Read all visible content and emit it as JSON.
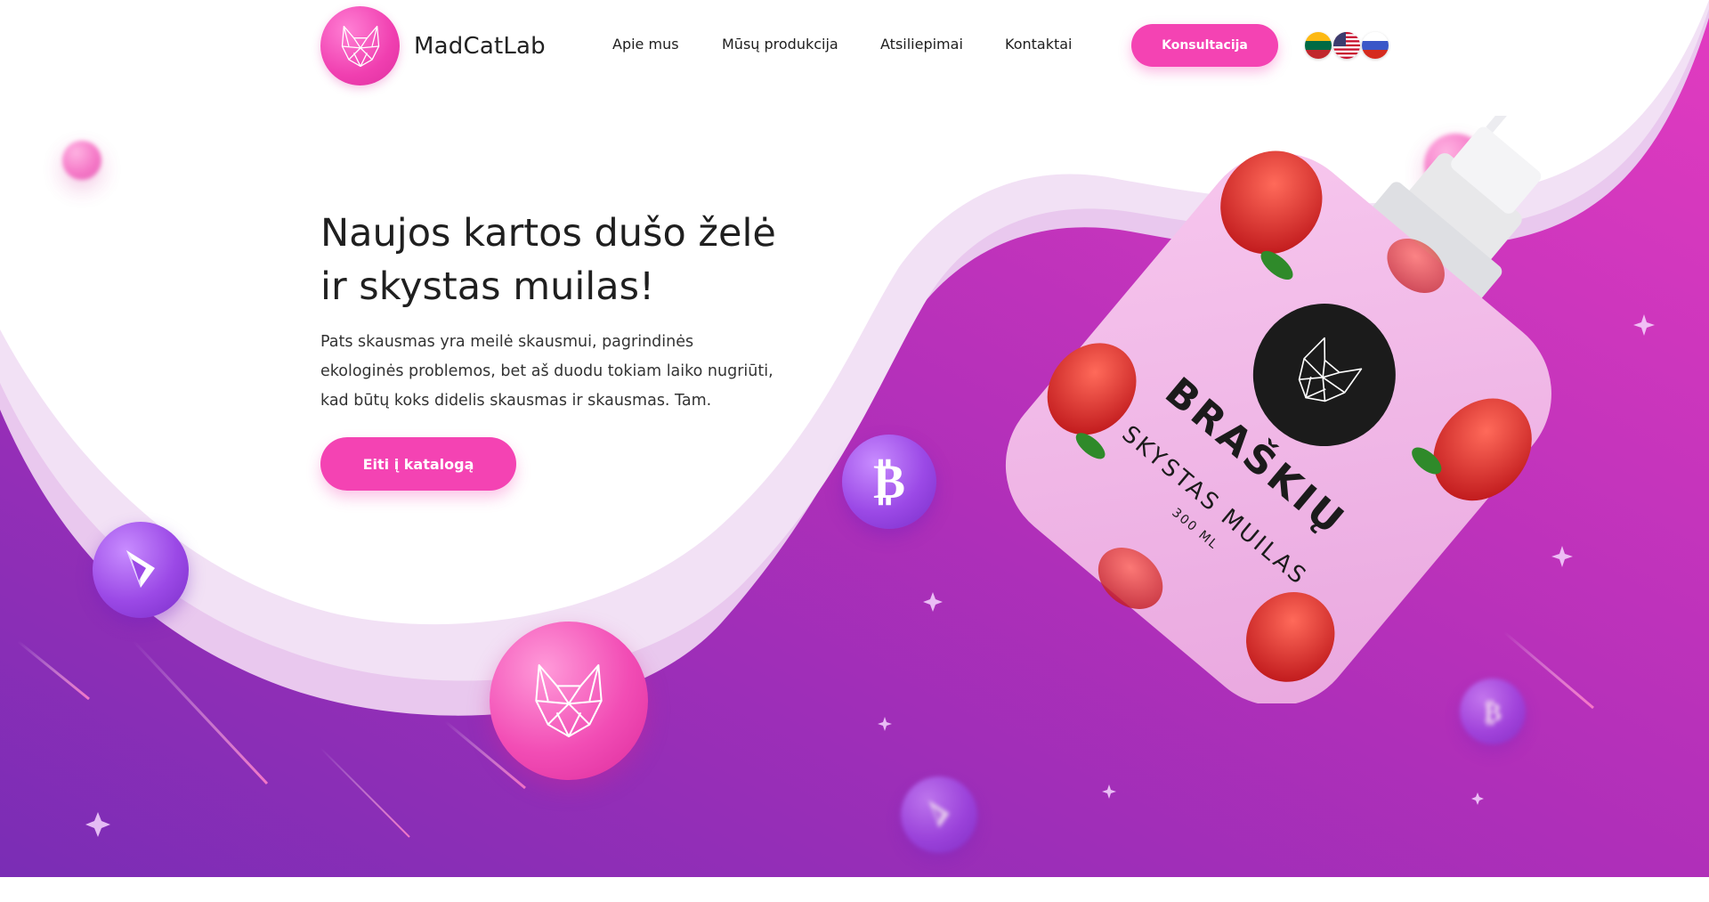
{
  "brand": {
    "name": "MadCatLab",
    "logo_icon": "cat-geometric-icon"
  },
  "nav": {
    "items": [
      {
        "label": "Apie mus"
      },
      {
        "label": "Mūsų produkcija"
      },
      {
        "label": "Atsiliepimai"
      },
      {
        "label": "Kontaktai"
      }
    ],
    "cta_label": "Konsultacija",
    "languages": [
      {
        "flag": "lithuania-flag-icon"
      },
      {
        "flag": "usa-flag-icon"
      },
      {
        "flag": "russia-flag-icon"
      }
    ]
  },
  "hero": {
    "title_lines": [
      "Naujos kartos dušo želė",
      "ir skystas muilas!"
    ],
    "description_lines": [
      "Pats skausmas yra meilė skausmui, pagrindinės",
      "ekologinės problemos, bet aš duodu tokiam laiko nugriūti,",
      "kad būtų koks didelis skausmas ir skausmas. Tam."
    ],
    "cta_label": "Eiti į katalogą"
  },
  "product": {
    "name": "BRAŠKIŲ",
    "type": "SKYSTAS MUILAS",
    "volume": "300 ML",
    "icon": "strawberry-soap-bottle-icon"
  },
  "colors": {
    "accent": "#f443b3",
    "purple_dark": "#7d2bb4",
    "purple_light": "#d63bb8",
    "text": "#1f1f1f"
  }
}
